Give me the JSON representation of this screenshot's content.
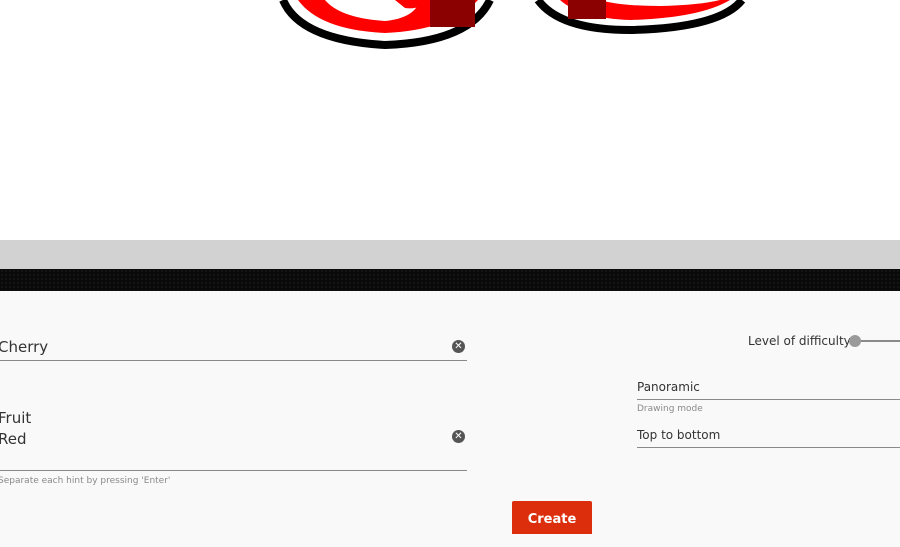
{
  "canvas": {
    "drawing": "cherry-drawing"
  },
  "form": {
    "name_value": "Cherry",
    "hints_lines": [
      "Fruit",
      "Red"
    ],
    "hints_helper": "Separate each hint by pressing 'Enter'",
    "difficulty_label": "Level of difficulty",
    "difficulty_level": 0,
    "view_mode_value": "Panoramic",
    "view_mode_label": "Drawing mode",
    "direction_value": "Top to bottom",
    "create_label": "Create",
    "clear_icon": "close-circle-icon"
  },
  "colors": {
    "accent": "#dc2e0c",
    "red": "#ff0000",
    "dark_red": "#8b0000"
  }
}
